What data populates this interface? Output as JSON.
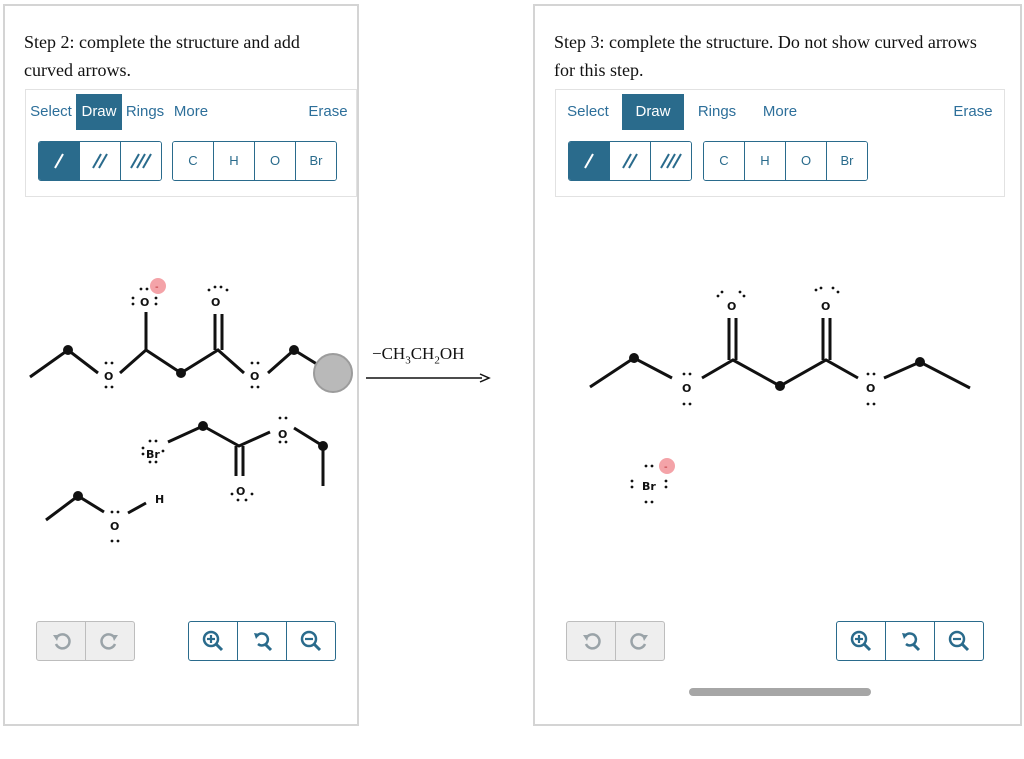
{
  "left_panel": {
    "title": "Step 2: complete the structure and add curved arrows.",
    "tabs": {
      "select": "Select",
      "draw": "Draw",
      "rings": "Rings",
      "more": "More",
      "erase": "Erase"
    },
    "atoms": [
      "C",
      "H",
      "O",
      "Br"
    ]
  },
  "right_panel": {
    "title": "Step 3: complete the structure. Do not show curved arrows for this step.",
    "tabs": {
      "select": "Select",
      "draw": "Draw",
      "rings": "Rings",
      "more": "More",
      "erase": "Erase"
    },
    "atoms": [
      "C",
      "H",
      "O",
      "Br"
    ]
  },
  "reaction_arrow": {
    "label_parts": [
      "−CH",
      "3",
      "CH",
      "2",
      "OH"
    ]
  },
  "molecule_atoms": {
    "oxygen": "O",
    "hydrogen": "H",
    "bromine": "Br",
    "charge_minus": "-"
  },
  "colors": {
    "accent": "#2a6b8c",
    "charge": "#f4a3a8",
    "disabled": "#eeeeee"
  },
  "icons": {
    "single_bond": "single-bond-icon",
    "double_bond": "double-bond-icon",
    "triple_bond": "triple-bond-icon",
    "undo": "undo-icon",
    "redo": "redo-icon",
    "zoom_in": "zoom-in-icon",
    "zoom_reset": "zoom-reset-icon",
    "zoom_out": "zoom-out-icon"
  }
}
